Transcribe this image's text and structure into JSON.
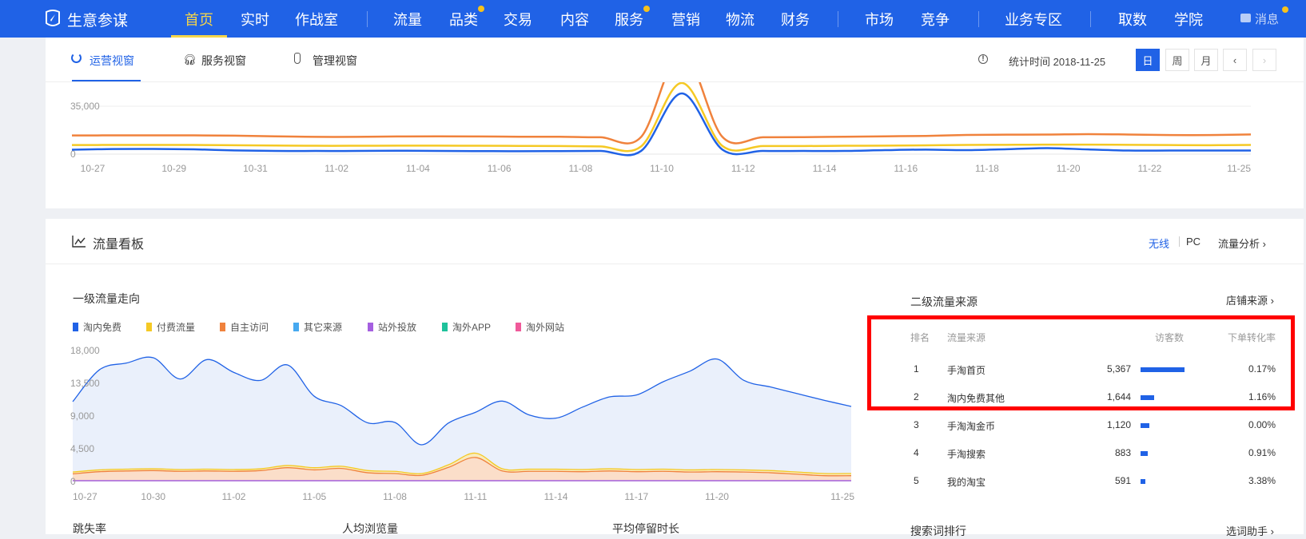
{
  "nav": {
    "brand": "生意参谋",
    "items": [
      {
        "label": "首页",
        "active": true
      },
      {
        "label": "实时"
      },
      {
        "label": "作战室"
      },
      {
        "label": "流量"
      },
      {
        "label": "品类",
        "dot": true
      },
      {
        "label": "交易"
      },
      {
        "label": "内容"
      },
      {
        "label": "服务",
        "dot": true
      },
      {
        "label": "营销"
      },
      {
        "label": "物流"
      },
      {
        "label": "财务"
      },
      {
        "label": "市场"
      },
      {
        "label": "竞争"
      },
      {
        "label": "业务专区"
      },
      {
        "label": "取数"
      },
      {
        "label": "学院"
      }
    ],
    "messages_label": "消息",
    "accent": "#2062e6",
    "active_color": "#f5d54a"
  },
  "view_tabs": [
    {
      "label": "运营视窗",
      "icon": "refresh-icon",
      "active": true
    },
    {
      "label": "服务视窗",
      "icon": "headset-icon"
    },
    {
      "label": "管理视窗",
      "icon": "badge-icon"
    }
  ],
  "stats": {
    "stat_time": "统计时间 2018-11-25",
    "periods": [
      "日",
      "周",
      "月"
    ],
    "active_period": "日",
    "prev": "‹",
    "next": "›"
  },
  "chart_data": [
    {
      "type": "line",
      "x": [
        "10-27",
        "10-28",
        "10-29",
        "10-30",
        "10-31",
        "11-01",
        "11-02",
        "11-03",
        "11-04",
        "11-05",
        "11-06",
        "11-07",
        "11-08",
        "11-09",
        "11-10",
        "11-11",
        "11-12",
        "11-13",
        "11-14",
        "11-15",
        "11-16",
        "11-17",
        "11-18",
        "11-19",
        "11-20",
        "11-21",
        "11-22",
        "11-23",
        "11-24",
        "11-25"
      ],
      "x_tick_labels": [
        "10-27",
        "10-29",
        "10-31",
        "11-02",
        "11-04",
        "11-06",
        "11-08",
        "11-10",
        "11-12",
        "11-14",
        "11-16",
        "11-18",
        "11-20",
        "11-22",
        "11-25"
      ],
      "y_tick_labels": [
        "35,000",
        "0"
      ],
      "ylim": [
        0,
        35000
      ],
      "grid": true,
      "series": [
        {
          "color": "#f0823c",
          "values": [
            13600,
            13700,
            13700,
            13700,
            13500,
            13000,
            12600,
            12600,
            12900,
            13000,
            12900,
            12700,
            12700,
            12300,
            12500,
            75000,
            12600,
            12300,
            12400,
            12700,
            13000,
            13300,
            14000,
            14200,
            14300,
            14600,
            14300,
            13900,
            13900,
            14400
          ]
        },
        {
          "color": "#f5c924",
          "values": [
            6600,
            6700,
            6700,
            6700,
            6500,
            6300,
            6100,
            6100,
            6200,
            6200,
            6100,
            6000,
            5900,
            5600,
            5600,
            52000,
            6000,
            5900,
            5900,
            6100,
            6200,
            6400,
            6700,
            6800,
            6900,
            6900,
            6800,
            6600,
            6500,
            6700
          ]
        },
        {
          "color": "#2062e6",
          "values": [
            3200,
            3700,
            3800,
            3500,
            2700,
            2300,
            2300,
            2300,
            2500,
            2300,
            2200,
            2100,
            2200,
            2300,
            2300,
            44300,
            3300,
            2300,
            2300,
            2300,
            2900,
            3300,
            2900,
            3600,
            4400,
            3400,
            2600,
            2600,
            2600,
            2600
          ]
        }
      ]
    },
    {
      "type": "area",
      "title": "一级流量走向",
      "legend": [
        {
          "name": "淘内免费",
          "color": "#2062e6"
        },
        {
          "name": "付费流量",
          "color": "#f5c924"
        },
        {
          "name": "自主访问",
          "color": "#f0823c"
        },
        {
          "name": "其它来源",
          "color": "#47a9f0"
        },
        {
          "name": "站外投放",
          "color": "#a55fe0"
        },
        {
          "name": "淘外APP",
          "color": "#1ec29b"
        },
        {
          "name": "淘外网站",
          "color": "#f05a9a"
        }
      ],
      "legend_placement": "top-left",
      "x": [
        "10-27",
        "10-28",
        "10-29",
        "10-30",
        "10-31",
        "11-01",
        "11-02",
        "11-03",
        "11-04",
        "11-05",
        "11-06",
        "11-07",
        "11-08",
        "11-09",
        "11-10",
        "11-11",
        "11-12",
        "11-13",
        "11-14",
        "11-15",
        "11-16",
        "11-17",
        "11-18",
        "11-19",
        "11-20",
        "11-21",
        "11-22",
        "11-23",
        "11-24",
        "11-25"
      ],
      "x_tick_labels": [
        "10-27",
        "10-30",
        "11-02",
        "11-05",
        "11-08",
        "11-11",
        "11-14",
        "11-17",
        "11-20",
        "11-25"
      ],
      "y_tick_labels": [
        "18,000",
        "13,500",
        "9,000",
        "4,500",
        "0"
      ],
      "ylim": [
        0,
        18000
      ],
      "grid": false,
      "series": [
        {
          "name": "淘内免费",
          "values": [
            10980,
            15370,
            16280,
            17010,
            14090,
            16760,
            15000,
            13900,
            16020,
            11710,
            10430,
            8050,
            8120,
            5050,
            8050,
            9510,
            11050,
            9150,
            8710,
            10240,
            11630,
            11890,
            13720,
            15180,
            16830,
            13900,
            12990,
            12070,
            11160,
            10320
          ]
        },
        {
          "name": "付费流量",
          "values": [
            1300,
            1600,
            1700,
            1750,
            1650,
            1700,
            1650,
            1750,
            2200,
            1900,
            2100,
            1500,
            1400,
            1100,
            2300,
            3900,
            1750,
            1700,
            1700,
            1650,
            1750,
            1650,
            1700,
            1600,
            1650,
            1600,
            1500,
            1300,
            1100,
            1100
          ]
        },
        {
          "name": "自主访问",
          "values": [
            1050,
            1350,
            1450,
            1500,
            1400,
            1450,
            1400,
            1500,
            1900,
            1600,
            1800,
            1200,
            1100,
            850,
            1950,
            3300,
            1450,
            1400,
            1400,
            1350,
            1450,
            1350,
            1400,
            1300,
            1350,
            1300,
            1200,
            1000,
            800,
            800
          ]
        },
        {
          "name": "站外投放",
          "values": [
            120,
            120,
            120,
            120,
            120,
            120,
            120,
            120,
            120,
            120,
            120,
            120,
            120,
            120,
            120,
            120,
            120,
            120,
            120,
            120,
            120,
            120,
            120,
            120,
            120,
            120,
            120,
            120,
            120,
            120
          ]
        }
      ]
    }
  ],
  "traffic_board": {
    "title": "流量看板",
    "wireless": "无线",
    "pc": "PC",
    "analysis_link": "流量分析 ›"
  },
  "secondary_sources": {
    "title": "二级流量来源",
    "link": "店铺来源 ›",
    "headers": [
      "排名",
      "流量来源",
      "访客数",
      "下单转化率"
    ],
    "rows": [
      {
        "rank": "1",
        "source": "手淘首页",
        "visitors": "5,367",
        "visitors_value": 5367,
        "rate": "0.17%"
      },
      {
        "rank": "2",
        "source": "淘内免费其他",
        "visitors": "1,644",
        "visitors_value": 1644,
        "rate": "1.16%"
      },
      {
        "rank": "3",
        "source": "手淘淘金币",
        "visitors": "1,120",
        "visitors_value": 1120,
        "rate": "0.00%"
      },
      {
        "rank": "4",
        "source": "手淘搜索",
        "visitors": "883",
        "visitors_value": 883,
        "rate": "0.91%"
      },
      {
        "rank": "5",
        "source": "我的淘宝",
        "visitors": "591",
        "visitors_value": 591,
        "rate": "3.38%"
      }
    ],
    "highlight_color": "#ff0000"
  },
  "bottom": {
    "metrics": [
      "跳失率",
      "人均浏览量",
      "平均停留时长"
    ],
    "search_rank_title": "搜索词排行",
    "search_rank_link": "选词助手 ›"
  }
}
